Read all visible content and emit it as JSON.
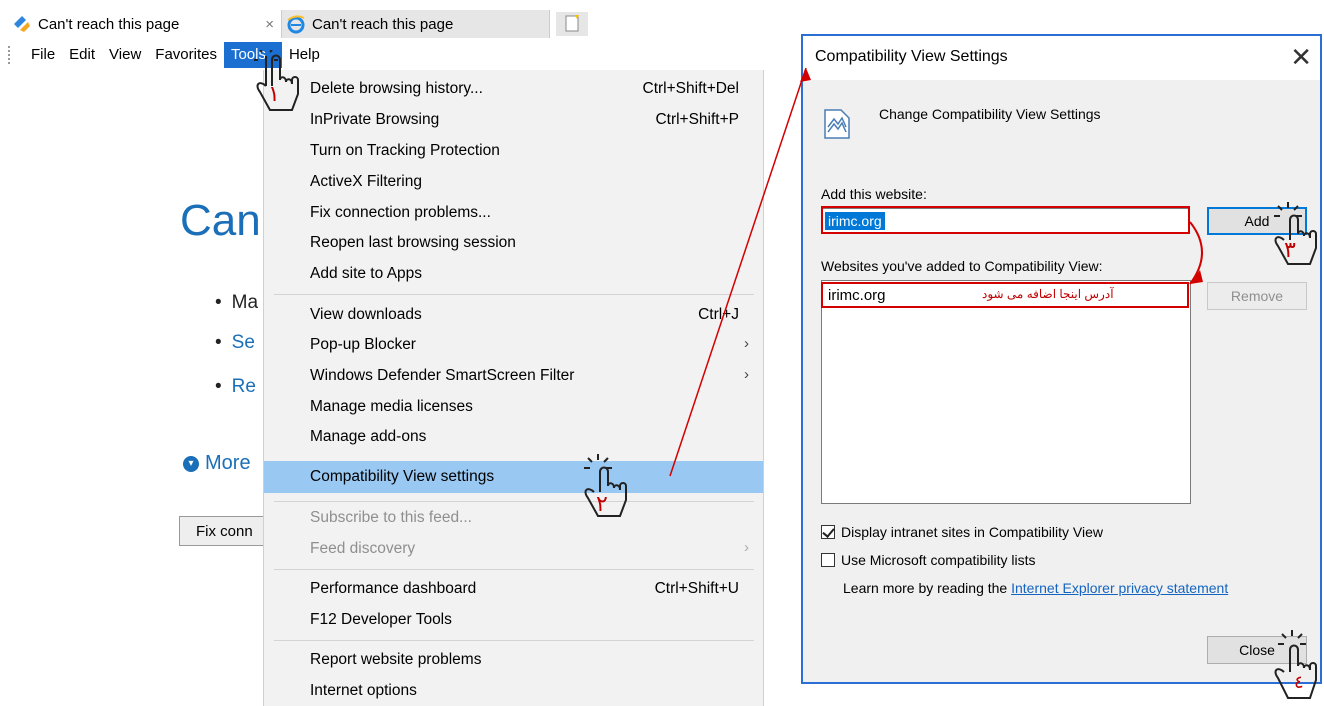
{
  "browser": {
    "tabs": [
      {
        "title": "Can't reach this page",
        "icon": "browser-logo-icon",
        "active": true
      },
      {
        "title": "Can't reach this page",
        "icon": "ie-logo-icon",
        "active": false
      }
    ],
    "close_glyph": "×",
    "menubar": [
      "File",
      "Edit",
      "View",
      "Favorites",
      "Tools",
      "Help"
    ],
    "page": {
      "heading": "Can",
      "bullets": [
        "Ma",
        "Se",
        "Re"
      ],
      "more": "More",
      "fix_button": "Fix conn"
    }
  },
  "tools_menu": {
    "items": [
      {
        "label": "Delete browsing history...",
        "shortcut": "Ctrl+Shift+Del"
      },
      {
        "label": "InPrivate Browsing",
        "shortcut": "Ctrl+Shift+P"
      },
      {
        "label": "Turn on Tracking Protection",
        "shortcut": ""
      },
      {
        "label": "ActiveX Filtering",
        "shortcut": ""
      },
      {
        "label": "Fix connection problems...",
        "shortcut": ""
      },
      {
        "label": "Reopen last browsing session",
        "shortcut": ""
      },
      {
        "label": "Add site to Apps",
        "shortcut": ""
      },
      {
        "label": "View downloads",
        "shortcut": "Ctrl+J"
      },
      {
        "label": "Pop-up Blocker",
        "shortcut": "",
        "submenu": true
      },
      {
        "label": "Windows Defender SmartScreen Filter",
        "shortcut": "",
        "submenu": true
      },
      {
        "label": "Manage media licenses",
        "shortcut": ""
      },
      {
        "label": "Manage add-ons",
        "shortcut": ""
      },
      {
        "label": "Compatibility View settings",
        "shortcut": "",
        "highlighted": true
      },
      {
        "label": "Subscribe to this feed...",
        "shortcut": "",
        "disabled": true
      },
      {
        "label": "Feed discovery",
        "shortcut": "",
        "disabled": true,
        "submenu": true
      },
      {
        "label": "Performance dashboard",
        "shortcut": "Ctrl+Shift+U"
      },
      {
        "label": "F12 Developer Tools",
        "shortcut": ""
      },
      {
        "label": "Report website problems",
        "shortcut": ""
      },
      {
        "label": "Internet options",
        "shortcut": ""
      }
    ],
    "submenu_arrow": "›"
  },
  "dialog": {
    "title": "Compatibility View Settings",
    "close_glyph": "✕",
    "heading": "Change Compatibility View Settings",
    "add_label": "Add this website:",
    "input_value": "irimc.org",
    "add_button": "Add",
    "list_label": "Websites you've added to Compatibility View:",
    "list_items": [
      "irimc.org"
    ],
    "list_note": "آدرس اینجا اضافه می شود",
    "remove_button": "Remove",
    "checkbox1": {
      "label": "Display intranet sites in Compatibility View",
      "checked": true
    },
    "checkbox2": {
      "label": "Use Microsoft compatibility lists",
      "checked": false
    },
    "learn_text": "Learn more by reading the",
    "learn_link": "Internet Explorer privacy statement",
    "close_button": "Close"
  },
  "annotations": {
    "step_numbers": [
      "١",
      "٢",
      "٣",
      "٤"
    ],
    "color": "#d40000"
  }
}
